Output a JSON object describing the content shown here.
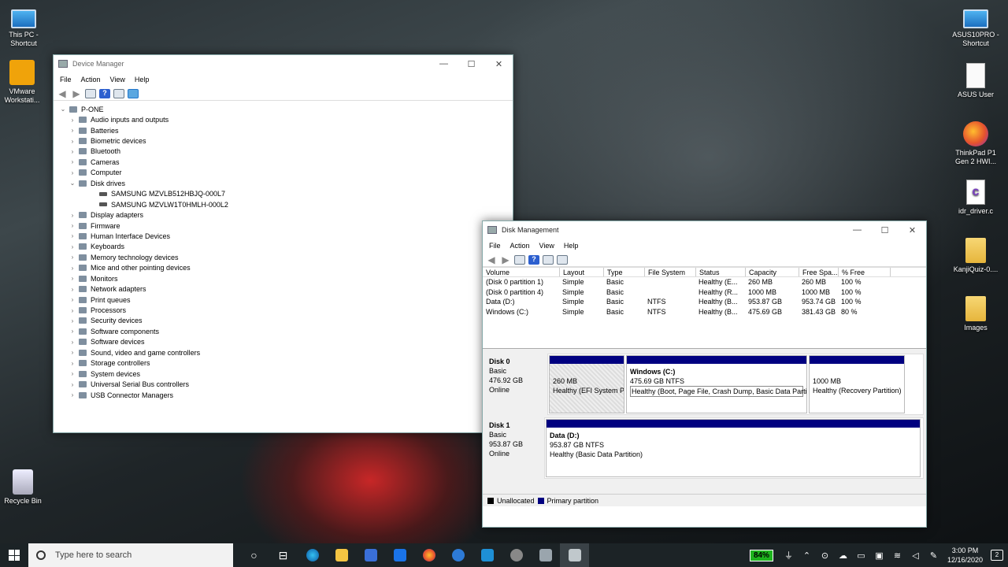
{
  "desktop": {
    "left_icons": [
      {
        "label": "This PC - Shortcut",
        "icon": "pc-icon"
      },
      {
        "label": "VMware Workstati...",
        "icon": "vmware-icon"
      },
      {
        "label": "Recycle Bin",
        "icon": "recycle-bin-icon"
      }
    ],
    "right_icons": [
      {
        "label": "ASUS10PRO - Shortcut",
        "icon": "pc-icon"
      },
      {
        "label": "ASUS User",
        "icon": "folder-icon"
      },
      {
        "label": "ThinkPad P1 Gen 2 HWI...",
        "icon": "firefox-icon"
      },
      {
        "label": "idr_driver.c",
        "icon": "c-file-icon"
      },
      {
        "label": "KanjiQuiz-0....",
        "icon": "folder-icon"
      },
      {
        "label": "Images",
        "icon": "folder-icon"
      }
    ]
  },
  "device_manager": {
    "title": "Device Manager",
    "controls": {
      "minimize": "—",
      "maximize": "☐",
      "close": "✕"
    },
    "menu": [
      "File",
      "Action",
      "View",
      "Help"
    ],
    "root": "P-ONE",
    "categories": [
      "Audio inputs and outputs",
      "Batteries",
      "Biometric devices",
      "Bluetooth",
      "Cameras",
      "Computer",
      "Disk drives"
    ],
    "disk_drives": [
      "SAMSUNG MZVLB512HBJQ-000L7",
      "SAMSUNG MZVLW1T0HMLH-000L2"
    ],
    "categories_after": [
      "Display adapters",
      "Firmware",
      "Human Interface Devices",
      "Keyboards",
      "Memory technology devices",
      "Mice and other pointing devices",
      "Monitors",
      "Network adapters",
      "Print queues",
      "Processors",
      "Security devices",
      "Software components",
      "Software devices",
      "Sound, video and game controllers",
      "Storage controllers",
      "System devices",
      "Universal Serial Bus controllers",
      "USB Connector Managers"
    ]
  },
  "disk_management": {
    "title": "Disk Management",
    "controls": {
      "minimize": "—",
      "maximize": "☐",
      "close": "✕"
    },
    "menu": [
      "File",
      "Action",
      "View",
      "Help"
    ],
    "columns": [
      "Volume",
      "Layout",
      "Type",
      "File System",
      "Status",
      "Capacity",
      "Free Spa...",
      "% Free"
    ],
    "volumes": [
      [
        "(Disk 0 partition 1)",
        "Simple",
        "Basic",
        "",
        "Healthy (E...",
        "260 MB",
        "260 MB",
        "100 %"
      ],
      [
        "(Disk 0 partition 4)",
        "Simple",
        "Basic",
        "",
        "Healthy (R...",
        "1000 MB",
        "1000 MB",
        "100 %"
      ],
      [
        "Data (D:)",
        "Simple",
        "Basic",
        "NTFS",
        "Healthy (B...",
        "953.87 GB",
        "953.74 GB",
        "100 %"
      ],
      [
        "Windows (C:)",
        "Simple",
        "Basic",
        "NTFS",
        "Healthy (B...",
        "475.69 GB",
        "381.43 GB",
        "80 %"
      ]
    ],
    "disks": [
      {
        "name": "Disk 0",
        "type": "Basic",
        "size": "476.92 GB",
        "state": "Online",
        "partitions": [
          {
            "name": "",
            "size": "260 MB",
            "status": "Healthy (EFI System P..."
          },
          {
            "name": "Windows  (C:)",
            "size": "475.69 GB NTFS",
            "status": "Healthy (Boot, Page File, Crash Dump, Basic Data Partition)"
          },
          {
            "name": "",
            "size": "1000 MB",
            "status": "Healthy (Recovery Partition)"
          }
        ]
      },
      {
        "name": "Disk 1",
        "type": "Basic",
        "size": "953.87 GB",
        "state": "Online",
        "partitions": [
          {
            "name": "Data  (D:)",
            "size": "953.87 GB NTFS",
            "status": "Healthy (Basic Data Partition)"
          }
        ]
      }
    ],
    "legend": [
      {
        "label": "Unallocated",
        "color": "#000000"
      },
      {
        "label": "Primary partition",
        "color": "#000080"
      }
    ]
  },
  "taskbar": {
    "search_placeholder": "Type here to search",
    "battery": "84%",
    "time": "3:00 PM",
    "date": "12/16/2020",
    "notifications": "2"
  }
}
